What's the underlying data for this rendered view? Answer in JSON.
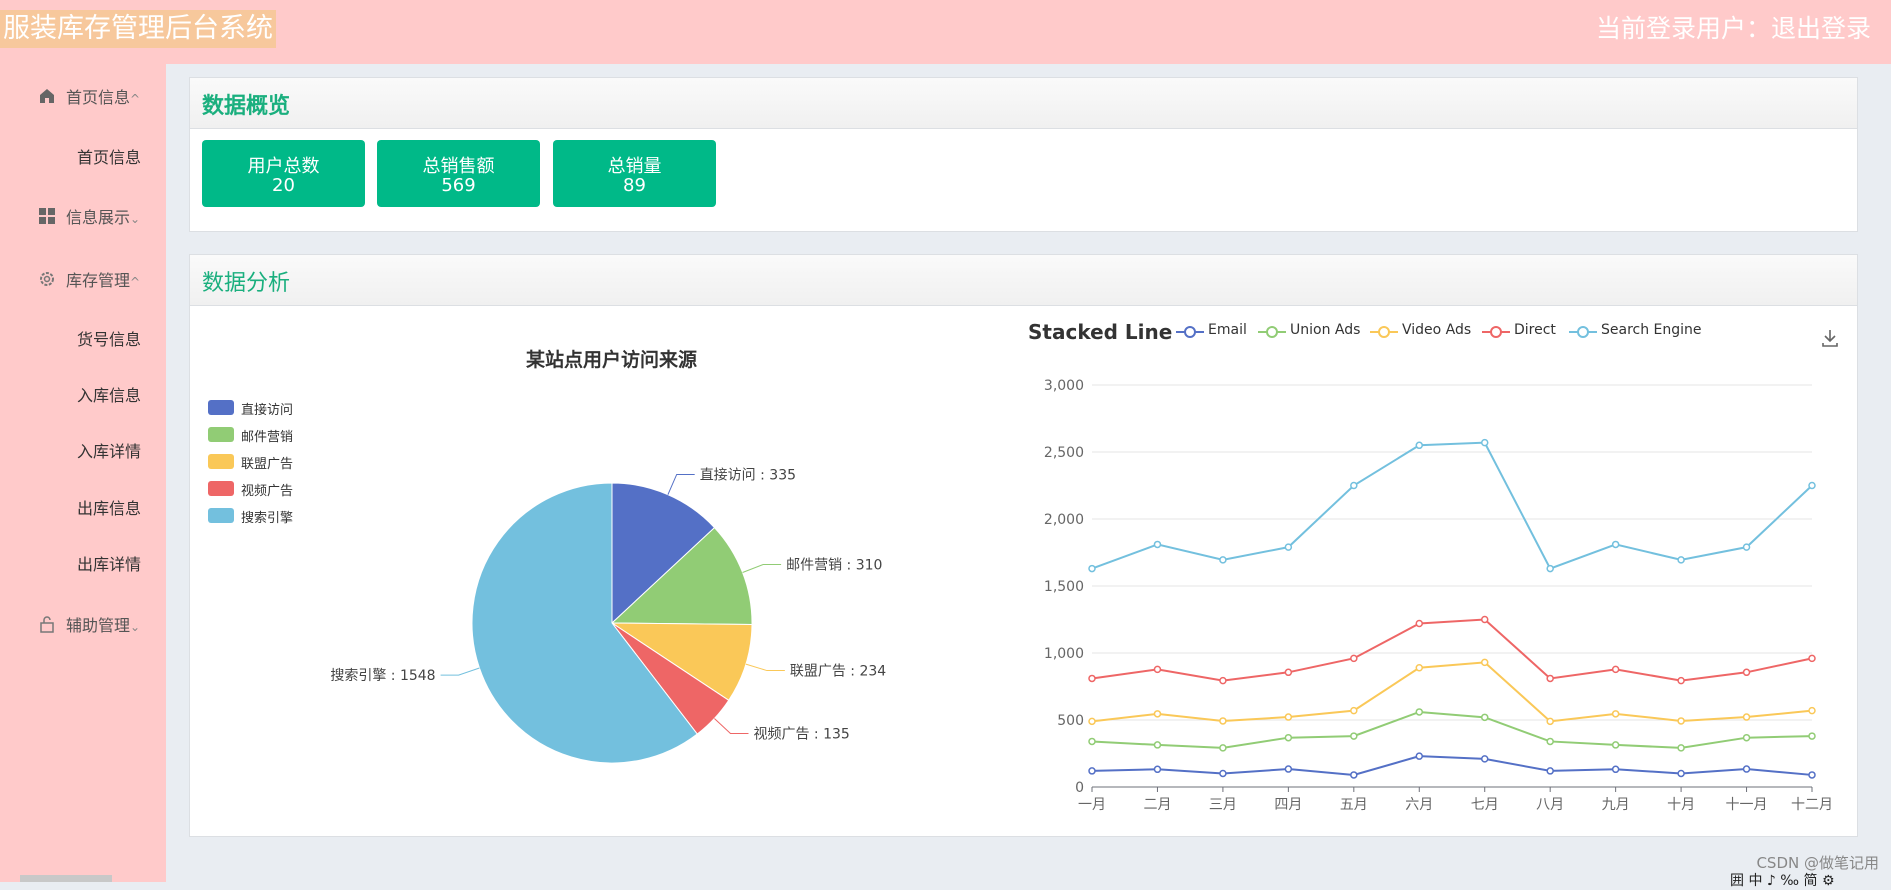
{
  "header": {
    "app_title": "服装库存管理后台系统",
    "user_text": "当前登录用户：退出登录"
  },
  "sidebar": {
    "groups": [
      {
        "label": "首页信息",
        "icon": "home-icon",
        "chevron": "^",
        "items": [
          "首页信息"
        ]
      },
      {
        "label": "信息展示",
        "icon": "grid-icon",
        "chevron": "⌄",
        "items": []
      },
      {
        "label": "库存管理",
        "icon": "gear-icon",
        "chevron": "^",
        "items": [
          "货号信息",
          "入库信息",
          "入库详情",
          "出库信息",
          "出库详情"
        ]
      },
      {
        "label": "辅助管理",
        "icon": "lock-icon",
        "chevron": "⌄",
        "items": []
      }
    ]
  },
  "overview": {
    "title": "数据概览",
    "cards": [
      {
        "label": "用户总数",
        "value": "20"
      },
      {
        "label": "总销售额",
        "value": "569"
      },
      {
        "label": "总销量",
        "value": "89"
      }
    ]
  },
  "analysis": {
    "title": "数据分析"
  },
  "colors": {
    "accent": "#00b988",
    "header_bg": "#ffcaca",
    "title_green": "#1aaf7e"
  },
  "chart_data": [
    {
      "type": "pie",
      "title": "某站点用户访问来源",
      "legend_placement": "top-left",
      "slices": [
        {
          "name": "直接访问",
          "value": 335,
          "color": "#5470c6"
        },
        {
          "name": "邮件营销",
          "value": 310,
          "color": "#91cc75"
        },
        {
          "name": "联盟广告",
          "value": 234,
          "color": "#fac858"
        },
        {
          "name": "视频广告",
          "value": 135,
          "color": "#ee6666"
        },
        {
          "name": "搜索引擎",
          "value": 1548,
          "color": "#73c0de"
        }
      ],
      "label_sep": " : "
    },
    {
      "type": "line",
      "title": "Stacked Line",
      "stacked": true,
      "legend_placement": "top",
      "categories": [
        "一月",
        "二月",
        "三月",
        "四月",
        "五月",
        "六月",
        "七月",
        "八月",
        "九月",
        "十月",
        "十一月",
        "十二月"
      ],
      "ylim": [
        0,
        3000
      ],
      "yticks": [
        0,
        500,
        1000,
        1500,
        2000,
        2500,
        3000
      ],
      "ytick_labels": [
        "0",
        "500",
        "1,000",
        "1,500",
        "2,000",
        "2,500",
        "3,000"
      ],
      "grid": true,
      "series": [
        {
          "name": "Email",
          "color": "#5470c6",
          "values": [
            120,
            132,
            101,
            134,
            90,
            230,
            210,
            120,
            132,
            101,
            134,
            90
          ]
        },
        {
          "name": "Union Ads",
          "color": "#91cc75",
          "values": [
            220,
            182,
            191,
            234,
            290,
            330,
            310,
            220,
            182,
            191,
            234,
            290
          ]
        },
        {
          "name": "Video Ads",
          "color": "#fac858",
          "values": [
            150,
            232,
            201,
            154,
            190,
            330,
            410,
            150,
            232,
            201,
            154,
            190
          ]
        },
        {
          "name": "Direct",
          "color": "#ee6666",
          "values": [
            320,
            332,
            301,
            334,
            390,
            330,
            320,
            320,
            332,
            301,
            334,
            390
          ]
        },
        {
          "name": "Search Engine",
          "color": "#73c0de",
          "values": [
            820,
            932,
            901,
            934,
            1290,
            1330,
            1320,
            820,
            932,
            901,
            934,
            1290
          ]
        }
      ]
    }
  ],
  "footer": {
    "watermark": "CSDN @做笔记用",
    "bottom_glyphs": "囲 中 ♪ ‰ 简 ⚙"
  }
}
